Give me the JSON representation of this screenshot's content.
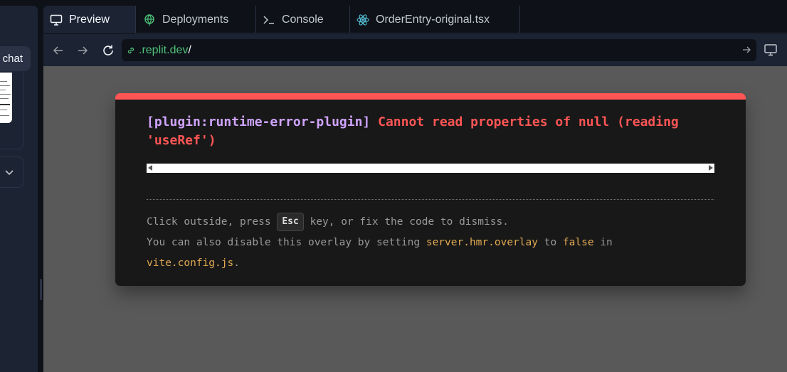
{
  "chat_panel": {
    "chat_button_label": "chat"
  },
  "tabs": [
    {
      "label": "Preview",
      "icon": "monitor-icon",
      "active": true
    },
    {
      "label": "Deployments",
      "icon": "globe-icon",
      "active": false
    },
    {
      "label": "Console",
      "icon": "terminal-icon",
      "active": false
    },
    {
      "label": "OrderEntry-original.tsx",
      "icon": "react-icon",
      "active": false
    }
  ],
  "url_bar": {
    "host": ".replit.dev",
    "path": "/"
  },
  "error_overlay": {
    "plugin": "[plugin:runtime-error-plugin]",
    "message": "Cannot read properties of null (reading 'useRef')",
    "tip_prefix": "Click outside, press",
    "tip_key": "Esc",
    "tip_suffix": "key, or fix the code to dismiss.",
    "tip_line2_prefix": "You can also disable this overlay by setting",
    "tip_setting": "server.hmr.overlay",
    "tip_to": "to",
    "tip_value": "false",
    "tip_in": "in",
    "tip_file": "vite.config.js",
    "tip_period": "."
  },
  "colors": {
    "accent_error": "#ff5555",
    "plugin_purple": "#cfa4ff",
    "code_yellow": "#e2aa53",
    "url_green": "#4ec27c"
  }
}
